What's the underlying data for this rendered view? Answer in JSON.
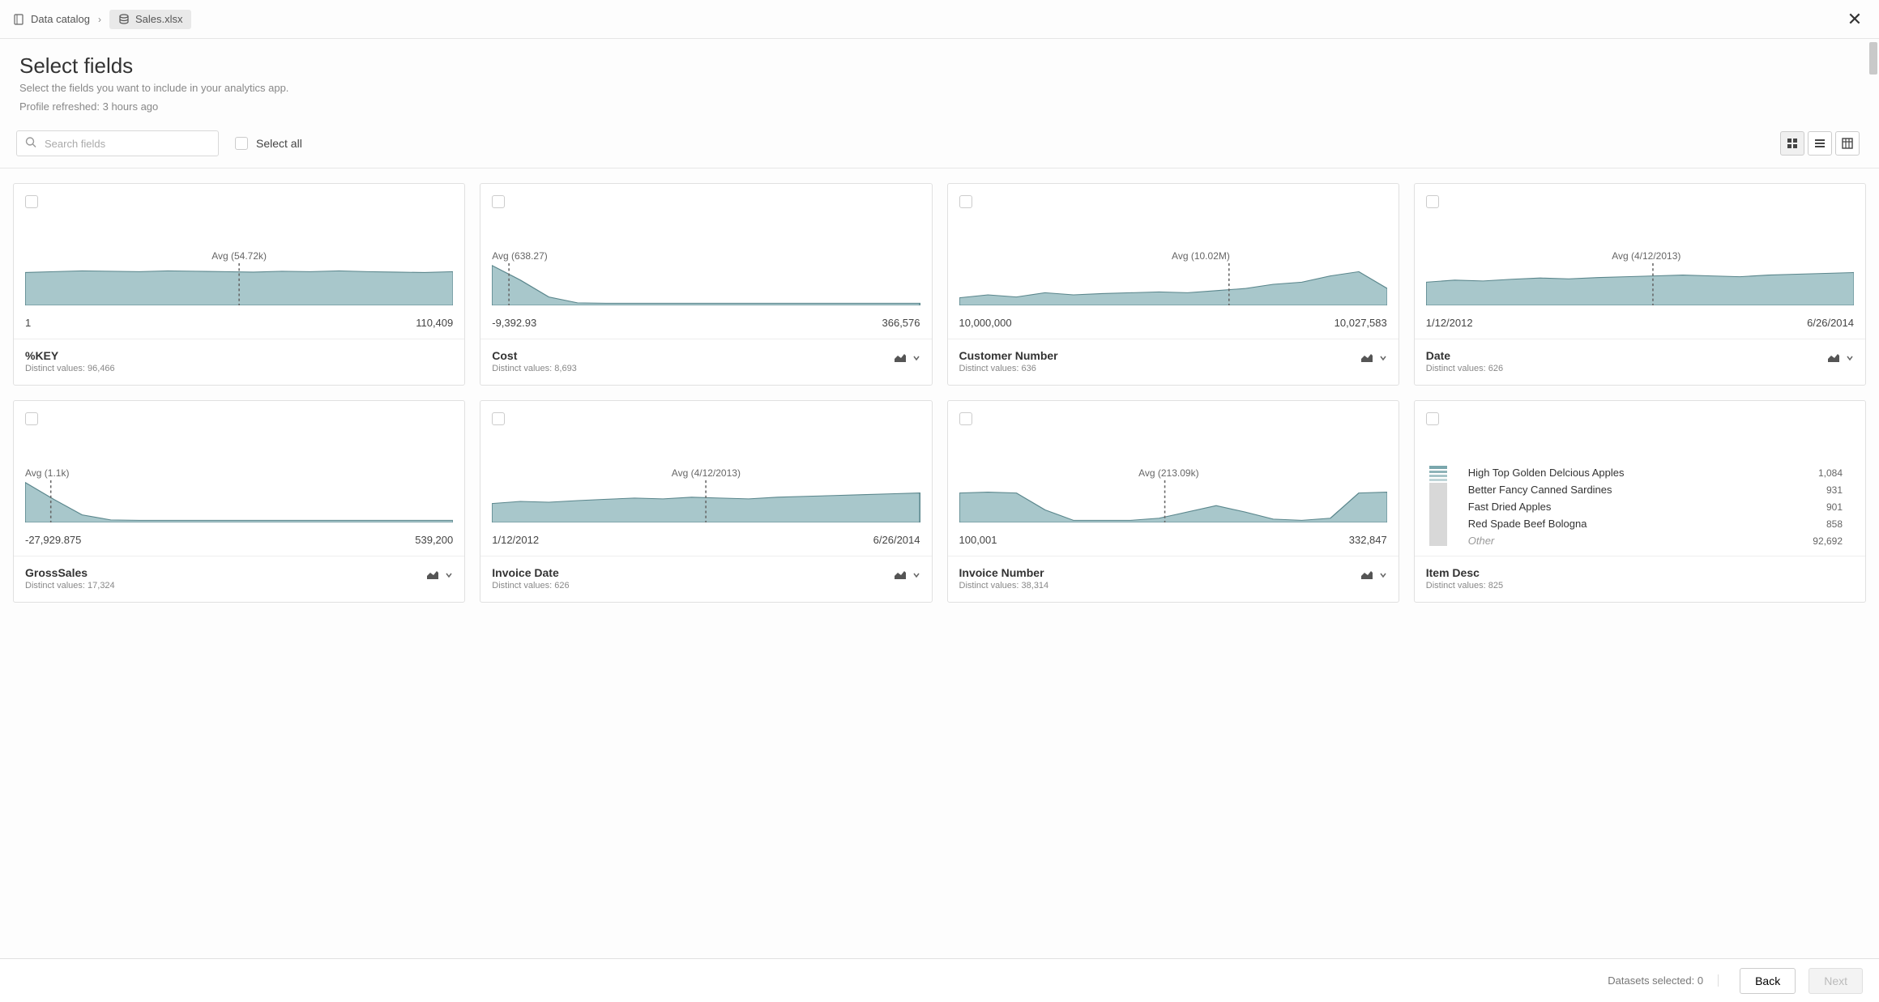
{
  "breadcrumb": {
    "catalog_label": "Data catalog",
    "dataset_label": "Sales.xlsx"
  },
  "close_glyph": "✕",
  "header": {
    "title": "Select fields",
    "subtitle": "Select the fields you want to include in your analytics app.",
    "refresh": "Profile refreshed: 3 hours ago"
  },
  "controls": {
    "search_placeholder": "Search fields",
    "select_all_label": "Select all"
  },
  "chart_data": [
    {
      "type": "area",
      "name": "%KEY",
      "avg_label": "Avg (54.72k)",
      "avg_pos": 0.5,
      "range_min": "1",
      "range_max": "110,409",
      "distinct": "Distinct values: 96,466",
      "distinct_n": 96466,
      "has_chart_toggle": false,
      "points": [
        0.78,
        0.8,
        0.82,
        0.81,
        0.8,
        0.82,
        0.81,
        0.8,
        0.79,
        0.81,
        0.8,
        0.82,
        0.8,
        0.79,
        0.78,
        0.8
      ]
    },
    {
      "type": "area",
      "name": "Cost",
      "avg_label": "Avg (638.27)",
      "avg_pos": 0.04,
      "range_min": "-9,392.93",
      "range_max": "366,576",
      "distinct": "Distinct values: 8,693",
      "distinct_n": 8693,
      "has_chart_toggle": true,
      "points": [
        0.95,
        0.6,
        0.2,
        0.06,
        0.05,
        0.05,
        0.05,
        0.05,
        0.05,
        0.05,
        0.05,
        0.05,
        0.05,
        0.05,
        0.05,
        0.05
      ]
    },
    {
      "type": "area",
      "name": "Customer Number",
      "avg_label": "Avg (10.02M)",
      "avg_pos": 0.63,
      "range_min": "10,000,000",
      "range_max": "10,027,583",
      "distinct": "Distinct values: 636",
      "distinct_n": 636,
      "has_chart_toggle": true,
      "points": [
        0.18,
        0.25,
        0.2,
        0.3,
        0.25,
        0.28,
        0.3,
        0.32,
        0.3,
        0.35,
        0.4,
        0.5,
        0.55,
        0.7,
        0.8,
        0.4
      ]
    },
    {
      "type": "area",
      "name": "Date",
      "avg_label": "Avg (4/12/2013)",
      "avg_pos": 0.53,
      "range_min": "1/12/2012",
      "range_max": "6/26/2014",
      "distinct": "Distinct values: 626",
      "distinct_n": 626,
      "has_chart_toggle": true,
      "points": [
        0.55,
        0.6,
        0.58,
        0.62,
        0.65,
        0.63,
        0.66,
        0.68,
        0.7,
        0.72,
        0.7,
        0.68,
        0.72,
        0.74,
        0.76,
        0.78
      ]
    },
    {
      "type": "area",
      "name": "GrossSales",
      "avg_label": "Avg (1.1k)",
      "avg_pos": 0.06,
      "range_min": "-27,929.875",
      "range_max": "539,200",
      "distinct": "Distinct values: 17,324",
      "distinct_n": 17324,
      "has_chart_toggle": true,
      "points": [
        0.95,
        0.55,
        0.18,
        0.06,
        0.05,
        0.05,
        0.05,
        0.05,
        0.05,
        0.05,
        0.05,
        0.05,
        0.05,
        0.05,
        0.05,
        0.05
      ]
    },
    {
      "type": "area",
      "name": "Invoice Date",
      "avg_label": "Avg (4/12/2013)",
      "avg_pos": 0.5,
      "range_min": "1/12/2012",
      "range_max": "6/26/2014",
      "distinct": "Distinct values: 626",
      "distinct_n": 626,
      "has_chart_toggle": true,
      "points": [
        0.45,
        0.5,
        0.48,
        0.52,
        0.55,
        0.58,
        0.56,
        0.6,
        0.58,
        0.56,
        0.6,
        0.62,
        0.64,
        0.66,
        0.68,
        0.7
      ]
    },
    {
      "type": "area",
      "name": "Invoice Number",
      "avg_label": "Avg (213.09k)",
      "avg_pos": 0.48,
      "range_min": "100,001",
      "range_max": "332,847",
      "distinct": "Distinct values: 38,314",
      "distinct_n": 38314,
      "has_chart_toggle": true,
      "points": [
        0.7,
        0.72,
        0.7,
        0.3,
        0.05,
        0.05,
        0.05,
        0.1,
        0.25,
        0.4,
        0.25,
        0.08,
        0.05,
        0.1,
        0.7,
        0.72
      ]
    },
    {
      "type": "bar",
      "name": "Item Desc",
      "distinct": "Distinct values: 825",
      "distinct_n": 825,
      "has_chart_toggle": false,
      "categories": [
        {
          "label": "High Top Golden Delcious Apples",
          "value": "1,084",
          "n": 1084
        },
        {
          "label": "Better Fancy Canned Sardines",
          "value": "931",
          "n": 931
        },
        {
          "label": "Fast Dried Apples",
          "value": "901",
          "n": 901
        },
        {
          "label": "Red Spade Beef Bologna",
          "value": "858",
          "n": 858
        },
        {
          "label": "Other",
          "value": "92,692",
          "n": 92692,
          "is_other": true
        }
      ]
    }
  ],
  "footer": {
    "datasets_selected_label": "Datasets selected:",
    "datasets_selected_count": "0",
    "back_label": "Back",
    "next_label": "Next"
  }
}
